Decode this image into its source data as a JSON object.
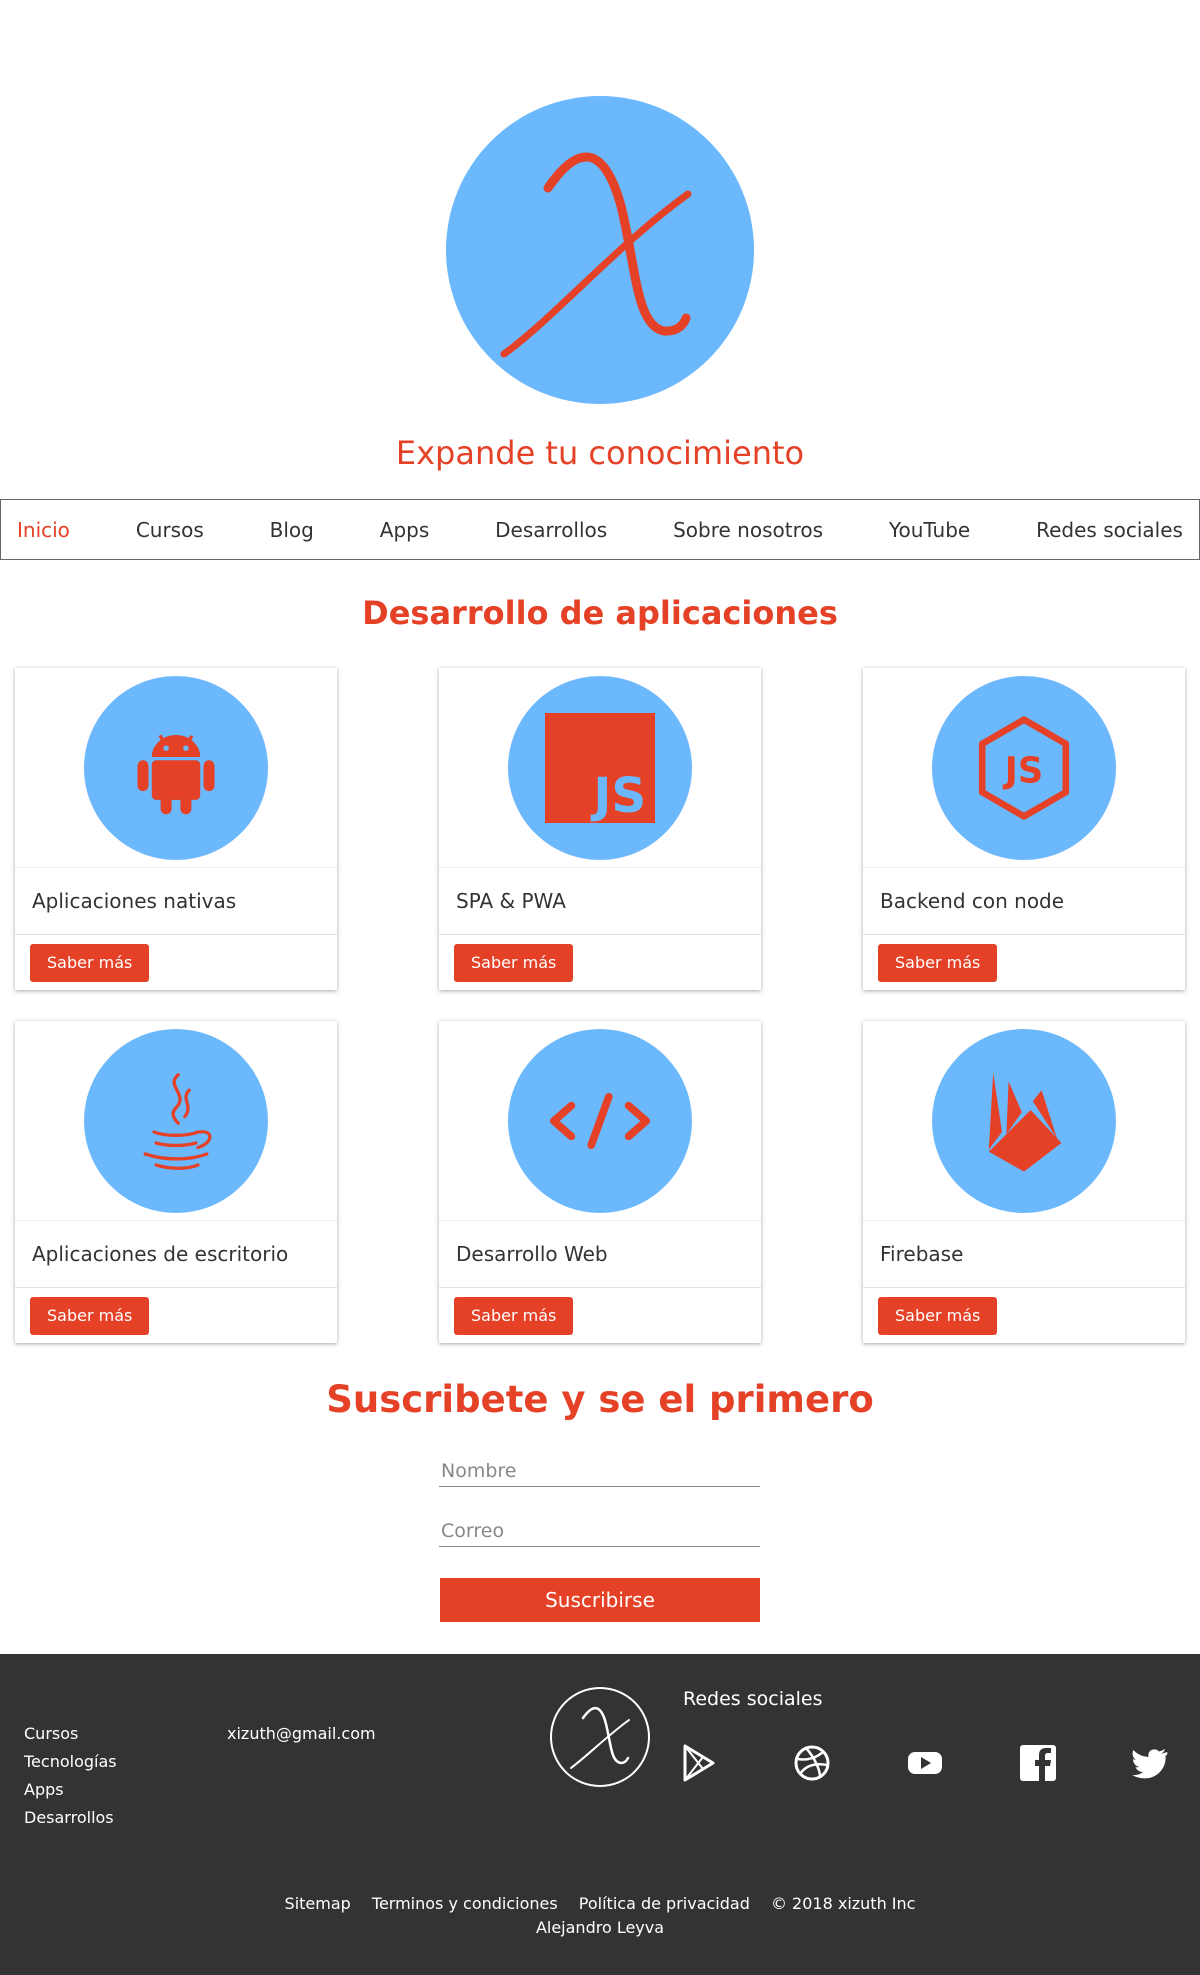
{
  "brand": {
    "tagline": "Expande tu conocimiento",
    "accent_color": "#e44127",
    "logo_bg_color": "#6bb8fd"
  },
  "nav": {
    "items": [
      "Inicio",
      "Cursos",
      "Blog",
      "Apps",
      "Desarrollos",
      "Sobre nosotros",
      "YouTube",
      "Redes sociales"
    ],
    "active": "Inicio"
  },
  "apps_section": {
    "title": "Desarrollo de aplicaciones",
    "cards": [
      {
        "title": "Aplicaciones nativas",
        "icon": "android-icon",
        "button": "Saber más"
      },
      {
        "title": "SPA & PWA",
        "icon": "javascript-icon",
        "button": "Saber más"
      },
      {
        "title": "Backend con node",
        "icon": "nodejs-icon",
        "button": "Saber más"
      },
      {
        "title": "Aplicaciones de escritorio",
        "icon": "java-icon",
        "button": "Saber más"
      },
      {
        "title": "Desarrollo Web",
        "icon": "code-icon",
        "button": "Saber más"
      },
      {
        "title": "Firebase",
        "icon": "firebase-icon",
        "button": "Saber más"
      }
    ]
  },
  "subscribe": {
    "title": "Suscribete y se el primero",
    "name_placeholder": "Nombre",
    "email_placeholder": "Correo",
    "button": "Suscribirse"
  },
  "footer": {
    "links": [
      "Cursos",
      "Tecnologías",
      "Apps",
      "Desarrollos"
    ],
    "email": "xizuth@gmail.com",
    "social_title": "Redes sociales",
    "social_icons": [
      "google-play-icon",
      "dribbble-icon",
      "youtube-icon",
      "facebook-icon",
      "twitter-icon"
    ],
    "bottom_links": [
      "Sitemap",
      "Terminos y condiciones",
      "Política de privacidad"
    ],
    "copyright": "© 2018 xizuth Inc",
    "author": "Alejandro Leyva"
  }
}
